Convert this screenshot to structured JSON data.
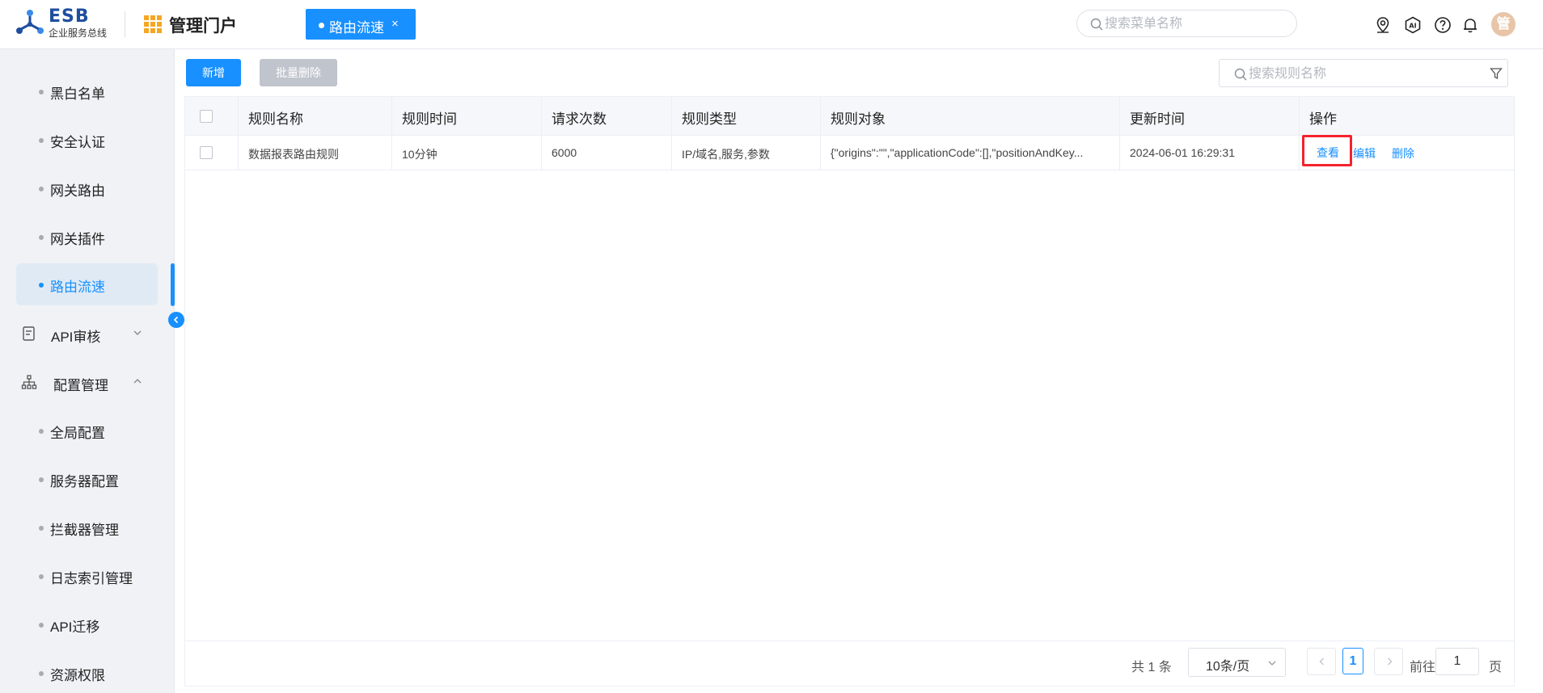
{
  "header": {
    "logo_title": "ESB",
    "logo_subtitle": "企业服务总线",
    "portal_title": "管理门户",
    "active_tab": {
      "label": "路由流速",
      "close": "×"
    },
    "menu_search": {
      "placeholder": "搜索菜单名称",
      "value": ""
    },
    "icons": [
      "location-icon",
      "ai-icon",
      "help-icon",
      "bell-icon"
    ],
    "avatar_text": "管"
  },
  "sidebar": {
    "items_top": [
      {
        "label": "黑白名单"
      },
      {
        "label": "安全认证"
      },
      {
        "label": "网关路由"
      },
      {
        "label": "网关插件"
      },
      {
        "label": "路由流速",
        "active": true
      }
    ],
    "groups": [
      {
        "label": "API审核",
        "expanded": false
      },
      {
        "label": "配置管理",
        "expanded": true
      }
    ],
    "config_items": [
      {
        "label": "全局配置"
      },
      {
        "label": "服务器配置"
      },
      {
        "label": "拦截器管理"
      },
      {
        "label": "日志索引管理"
      },
      {
        "label": "API迁移"
      },
      {
        "label": "资源权限"
      }
    ]
  },
  "toolbar": {
    "add_label": "新增",
    "batch_delete_label": "批量删除",
    "rule_search": {
      "placeholder": "搜索规则名称",
      "value": ""
    }
  },
  "table": {
    "columns": [
      "规则名称",
      "规则时间",
      "请求次数",
      "规则类型",
      "规则对象",
      "更新时间",
      "操作"
    ],
    "rows": [
      {
        "name": "数据报表路由规则",
        "time": "10分钟",
        "count": "6000",
        "type": "IP/域名,服务,参数",
        "object": "{\"origins\":\"\",\"applicationCode\":[],\"positionAndKey...",
        "updated": "2024-06-01 16:29:31",
        "actions": {
          "view": "查看",
          "edit": "编辑",
          "delete": "删除"
        }
      }
    ]
  },
  "pagination": {
    "total_text": "共 1 条",
    "page_size": "10条/页",
    "current_page": "1",
    "goto_label": "前往",
    "goto_value": "1",
    "page_label": "页"
  },
  "colors": {
    "primary": "#1890ff",
    "highlight_border": "#f5222d",
    "disabled_button": "#c0c4cc"
  }
}
